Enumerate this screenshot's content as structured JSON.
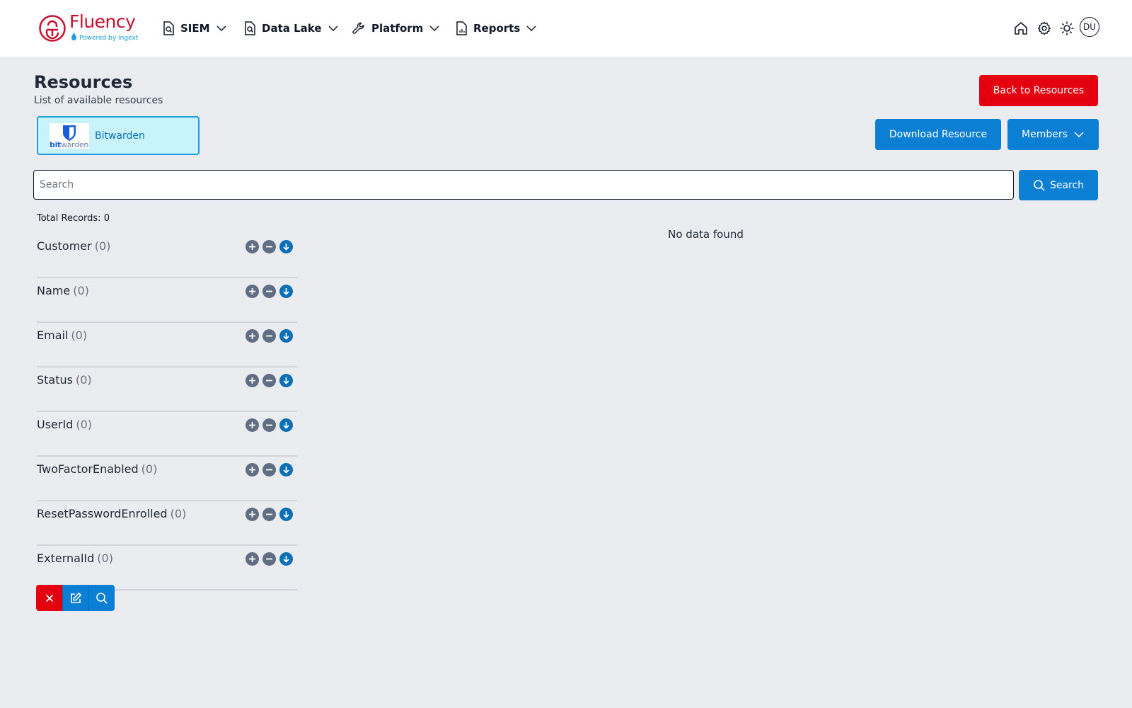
{
  "header": {
    "logo_word": "Fluency",
    "logo_sub": "Powered by Ingext",
    "nav": [
      {
        "label": "SIEM"
      },
      {
        "label": "Data Lake"
      },
      {
        "label": "Platform"
      },
      {
        "label": "Reports"
      }
    ],
    "icons": [
      "home-icon",
      "gear-icon",
      "sun-icon"
    ],
    "avatar_initials": "DU"
  },
  "page": {
    "title": "Resources",
    "subtitle": "List of available resources",
    "back_button": "Back to Resources",
    "download_button": "Download Resource",
    "members_button": "Members"
  },
  "resource": {
    "name": "Bitwarden",
    "logo_text_bold": "bit",
    "logo_text_light": "warden"
  },
  "search": {
    "placeholder": "Search",
    "value": "",
    "button": "Search"
  },
  "results": {
    "total_label": "Total Records: 0",
    "empty_text": "No data found"
  },
  "facets": [
    {
      "name": "Customer",
      "count": "(0)"
    },
    {
      "name": "Name",
      "count": "(0)"
    },
    {
      "name": "Email",
      "count": "(0)"
    },
    {
      "name": "Status",
      "count": "(0)"
    },
    {
      "name": "UserId",
      "count": "(0)"
    },
    {
      "name": "TwoFactorEnabled",
      "count": "(0)"
    },
    {
      "name": "ResetPasswordEnrolled",
      "count": "(0)"
    },
    {
      "name": "ExternalId",
      "count": "(0)"
    }
  ],
  "colors": {
    "brand_red": "#c8102e",
    "danger": "#e3000f",
    "primary": "#0b7fd4",
    "tile_bg": "#c9f3fb",
    "page_bg": "#ebecef"
  }
}
